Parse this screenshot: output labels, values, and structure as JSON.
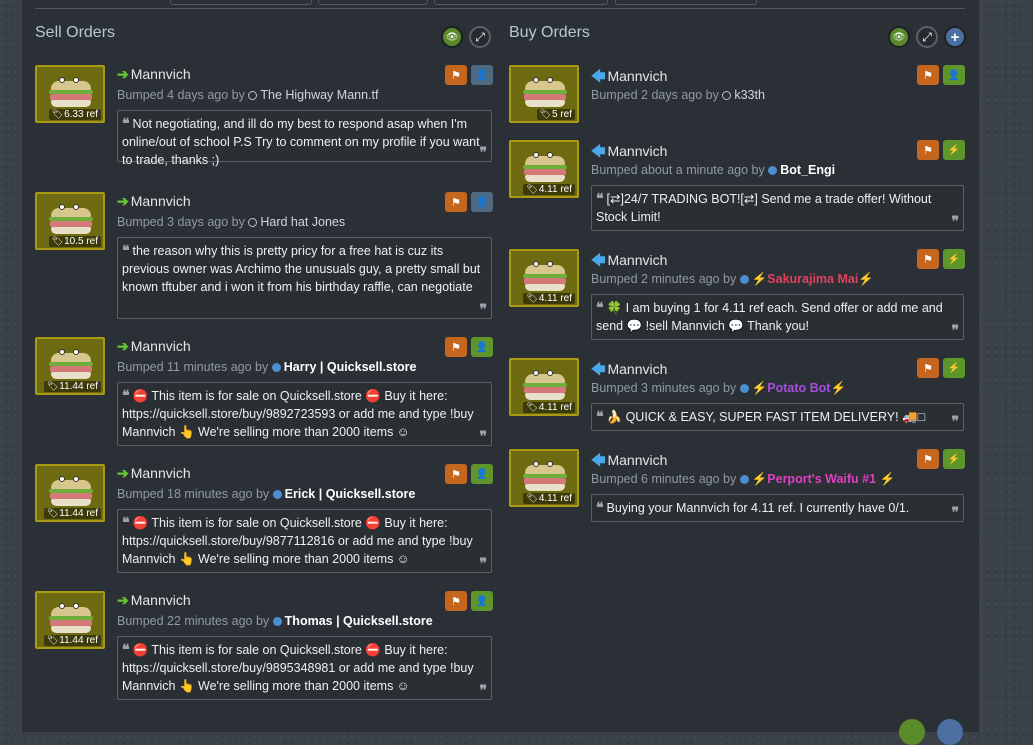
{
  "sell": {
    "title": "Sell Orders",
    "listings": [
      {
        "item": "Mannvich",
        "price": "6.33 ref",
        "bumped": "Bumped 4 days ago by",
        "user": "The Highway Mann.tf",
        "online": false,
        "note": "Not negotiating, and ill do my best to respond asap when I'm online/out of school P.S Try to comment on my profile if you want to trade, thanks ;)"
      },
      {
        "item": "Mannvich",
        "price": "10.5 ref",
        "bumped": "Bumped 3 days ago by",
        "user": "Hard hat Jones",
        "online": false,
        "note": "the reason why this is pretty pricy for a free hat is cuz its previous owner was Archimo the unusuals guy, a pretty small but known tftuber and i won it from his birthday raffle, can negotiate"
      },
      {
        "item": "Mannvich",
        "price": "11.44 ref",
        "bumped": "Bumped 11 minutes ago by",
        "user": "Harry | Quicksell.store",
        "online": true,
        "note": "⛔ This item is for sale on Quicksell.store ⛔ Buy it here: https://quicksell.store/buy/9892723593 or add me and type !buy Mannvich 👆 We're selling more than 2000 items ☺"
      },
      {
        "item": "Mannvich",
        "price": "11.44 ref",
        "bumped": "Bumped 18 minutes ago by",
        "user": "Erick | Quicksell.store",
        "online": true,
        "note": "⛔ This item is for sale on Quicksell.store ⛔ Buy it here: https://quicksell.store/buy/9877112816 or add me and type !buy Mannvich 👆 We're selling more than 2000 items ☺"
      },
      {
        "item": "Mannvich",
        "price": "11.44 ref",
        "bumped": "Bumped 22 minutes ago by",
        "user": "Thomas | Quicksell.store",
        "online": true,
        "note": "⛔ This item is for sale on Quicksell.store ⛔ Buy it here: https://quicksell.store/buy/9895348981 or add me and type !buy Mannvich 👆 We're selling more than 2000 items ☺"
      }
    ]
  },
  "buy": {
    "title": "Buy Orders",
    "listings": [
      {
        "item": "Mannvich",
        "price": "5 ref",
        "bumped": "Bumped 2 days ago by",
        "user": "k33th",
        "online": false,
        "note": ""
      },
      {
        "item": "Mannvich",
        "price": "4.11 ref",
        "bumped": "Bumped about a minute ago by",
        "user": "Bot_Engi",
        "online": true,
        "note": "[⇄]24/7 TRADING BOT![⇄] Send me a trade offer! Without Stock Limit!"
      },
      {
        "item": "Mannvich",
        "price": "4.11 ref",
        "bumped": "Bumped 2 minutes ago by",
        "user": "⚡Sakurajima Mai⚡",
        "online": true,
        "note": "🍀 I am buying 1 for 4.11 ref each. Send offer or add me and send 💬 !sell Mannvich 💬 Thank you!"
      },
      {
        "item": "Mannvich",
        "price": "4.11 ref",
        "bumped": "Bumped 3 minutes ago by",
        "user": "⚡Potato Bot⚡",
        "online": true,
        "note": "🍌 QUICK & EASY, SUPER FAST ITEM DELIVERY! 🚚□"
      },
      {
        "item": "Mannvich",
        "price": "4.11 ref",
        "bumped": "Bumped 6 minutes ago by",
        "user": "⚡Perport's Waifu #1 ⚡",
        "online": true,
        "note": "Buying your Mannvich for 4.11 ref. I currently have 0/1."
      }
    ]
  },
  "icons": {
    "quote_open": "❝",
    "quote_close": "❞",
    "flag": "⚑",
    "add_user": "👤",
    "bolt": "⚡",
    "eye": "👁",
    "expand": "⤢",
    "plus": "+",
    "arrow_right": "➔",
    "arrow_left": "🡄",
    "tag": "🏷"
  },
  "colors": {
    "panel": "#2b3036",
    "item_bg": "#6e6a11",
    "item_border": "#a99a15",
    "orange_btn": "#c6651d",
    "green_btn": "#5e962c",
    "slate_btn": "#4e6a82",
    "sell_arrow": "#67c23a",
    "buy_arrow": "#4aa8e8"
  }
}
